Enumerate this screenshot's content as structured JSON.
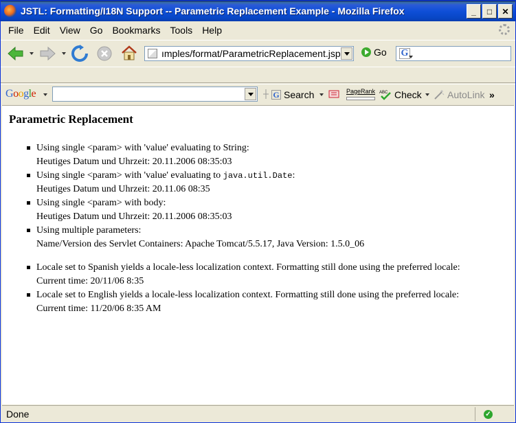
{
  "window": {
    "title": "JSTL: Formatting/I18N Support -- Parametric Replacement Example - Mozilla Firefox",
    "minimize": "_",
    "maximize": "□",
    "close": "✕"
  },
  "menu": {
    "file": "File",
    "edit": "Edit",
    "view": "View",
    "go": "Go",
    "bookmarks": "Bookmarks",
    "tools": "Tools",
    "help": "Help"
  },
  "navigation": {
    "url": "ımples/format/ParametricReplacement.jsp",
    "go_label": "Go",
    "search_engine_letter": "G"
  },
  "google_toolbar": {
    "logo_letters": [
      "G",
      "o",
      "o",
      "g",
      "l",
      "e"
    ],
    "logo_colors": [
      "#3366CC",
      "#CC2200",
      "#E8A300",
      "#3366CC",
      "#339933",
      "#CC2200"
    ],
    "search_label": "Search",
    "pagerank_label": "PageRank",
    "check_label": "Check",
    "autolink_label": "AutoLink",
    "more": "»"
  },
  "content": {
    "heading": "Parametric Replacement",
    "items": [
      {
        "line1": "Using single <param> with 'value' evaluating to String:",
        "line2": "Heutiges Datum und Uhrzeit: 20.11.2006 08:35:03"
      },
      {
        "line1_pre": "Using single <param> with 'value' evaluating to ",
        "line1_code": "java.util.Date",
        "line1_post": ":",
        "line2": "Heutiges Datum und Uhrzeit: 20.11.06 08:35"
      },
      {
        "line1": "Using single <param> with body:",
        "line2": "Heutiges Datum und Uhrzeit: 20.11.2006 08:35:03"
      },
      {
        "line1": "Using multiple parameters:",
        "line2": "Name/Version des Servlet Containers: Apache Tomcat/5.5.17, Java Version: 1.5.0_06"
      }
    ],
    "locale_items": [
      {
        "line1": "Locale set to Spanish yields a locale-less localization context. Formatting still done using the preferred locale:",
        "line2": "Current time: 20/11/06 8:35"
      },
      {
        "line1": "Locale set to English yields a locale-less localization context. Formatting still done using the preferred locale:",
        "line2": "Current time: 11/20/06 8:35 AM"
      }
    ]
  },
  "status": {
    "text": "Done",
    "ok_icon": "✓"
  }
}
